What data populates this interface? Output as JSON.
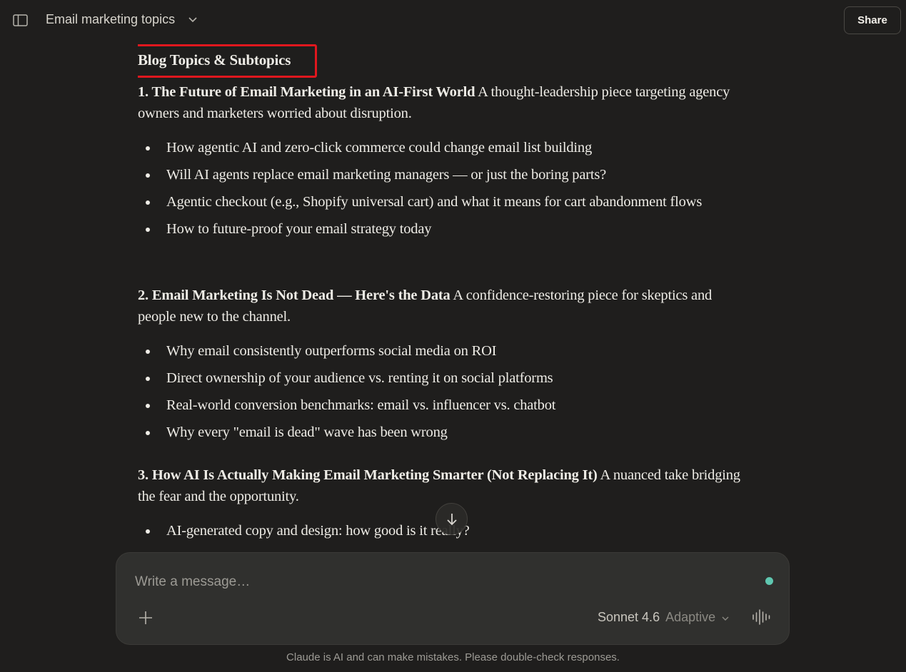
{
  "header": {
    "title": "Email marketing topics",
    "share_label": "Share",
    "icons": {
      "sidebar": "sidebar-toggle-icon",
      "title_menu": "chevron-down-icon"
    }
  },
  "response": {
    "heading": "Blog Topics & Subtopics",
    "sections": [
      {
        "title": "1. The Future of Email Marketing in an AI-First World",
        "description": " A thought-leadership piece targeting agency owners and marketers worried about disruption.",
        "bullets": [
          "How agentic AI and zero-click commerce could change email list building",
          "Will AI agents replace email marketing managers — or just the boring parts?",
          "Agentic checkout (e.g., Shopify universal cart) and what it means for cart abandonment flows",
          "How to future-proof your email strategy today"
        ]
      },
      {
        "title": "2. Email Marketing Is Not Dead — Here's the Data",
        "description": " A confidence-restoring piece for skeptics and people new to the channel.",
        "bullets": [
          "Why email consistently outperforms social media on ROI",
          "Direct ownership of your audience vs. renting it on social platforms",
          "Real-world conversion benchmarks: email vs. influencer vs. chatbot",
          "Why every \"email is dead\" wave has been wrong"
        ]
      },
      {
        "title": "3. How AI Is Actually Making Email Marketing Smarter (Not Replacing It)",
        "description": " A nuanced take bridging the fear and the opportunity.",
        "bullets": [
          "AI-generated copy and design: how good is it really?"
        ]
      }
    ]
  },
  "composer": {
    "placeholder": "Write a message…",
    "model_name": "Sonnet 4.6",
    "model_mode": "Adaptive",
    "status_color": "#5fc7b0"
  },
  "footer": {
    "disclaimer": "Claude is AI and can make mistakes. Please double-check responses."
  }
}
